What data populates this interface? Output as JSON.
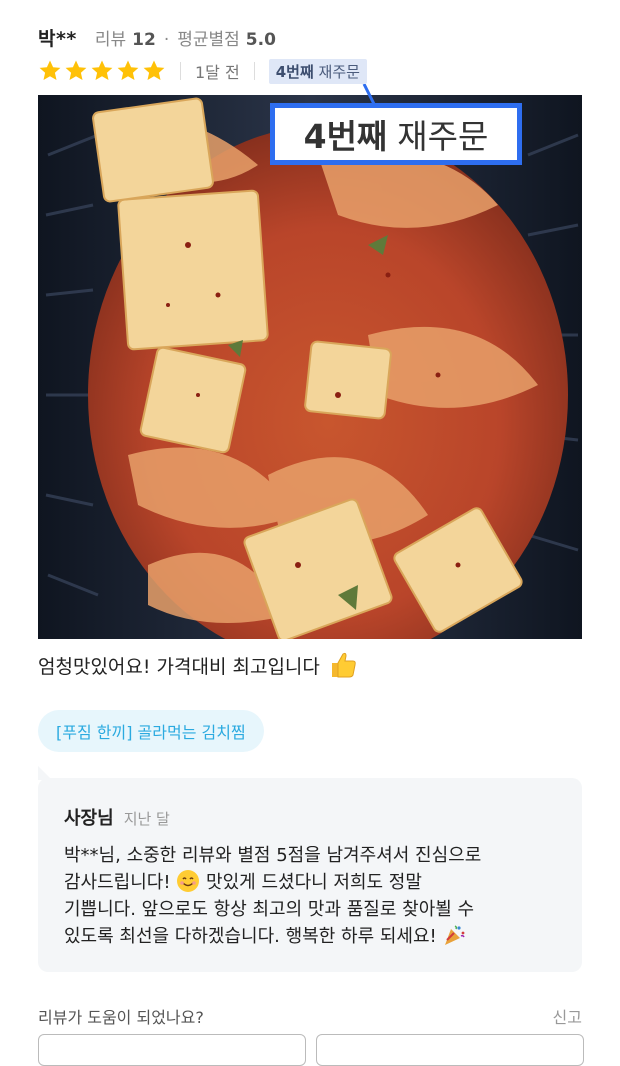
{
  "header": {
    "reviewer_name": "박**",
    "review_count_label": "리뷰",
    "review_count": "12",
    "separator": "·",
    "avg_rating_label": "평균별점",
    "avg_rating": "5.0"
  },
  "rating": {
    "stars": 5,
    "max_stars": 5,
    "star_color": "#ffc107",
    "posted": "1달 전",
    "reorder_count": "4번째",
    "reorder_label": "재주문"
  },
  "callout": {
    "count": "4번째",
    "label": "재주문",
    "border_color": "#2e6ef0"
  },
  "review": {
    "text": "엄청맛있어요! 가격대비 최고입니다",
    "emoji": "thumbs-up-icon"
  },
  "menu_tag": "[푸짐 한끼] 골라먹는 김치찜",
  "reply": {
    "author": "사장님",
    "time": "지난 달",
    "lines": [
      "박**님, 소중한 리뷰와 별점 5점을 남겨주셔서 진심으로",
      "감사드립니다!",
      "맛있게 드셨다니 저희도 정말",
      "기쁩니다. 앞으로도 항상 최고의 맛과 품질로 찾아뵐 수",
      "있도록 최선을 다하겠습니다. 행복한 하루 되세요!"
    ]
  },
  "footer": {
    "helpful_question": "리뷰가 도움이 되었나요?",
    "report": "신고"
  }
}
